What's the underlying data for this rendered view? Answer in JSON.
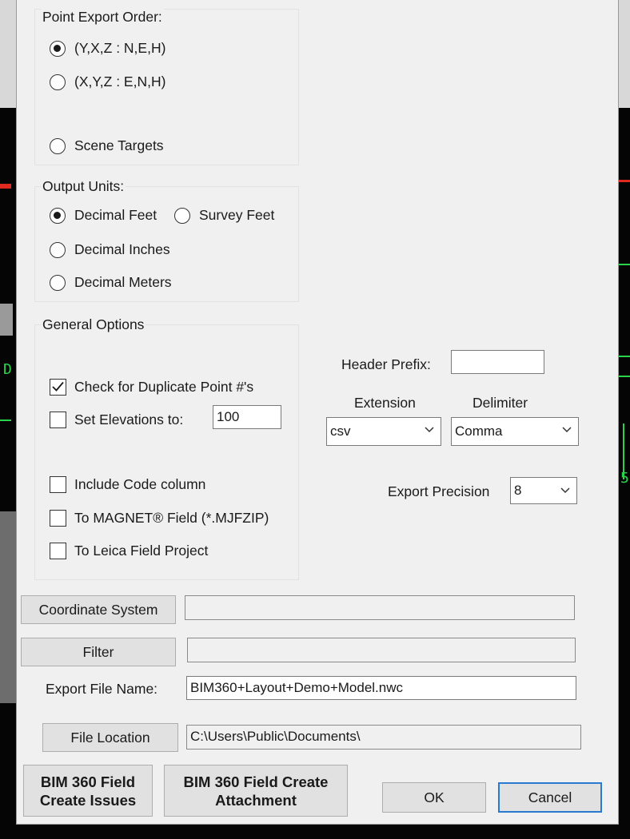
{
  "point_export_order": {
    "title": "Point Export Order:",
    "options": [
      {
        "label": "(Y,X,Z  :  N,E,H)",
        "checked": true
      },
      {
        "label": "(X,Y,Z  :  E,N,H)",
        "checked": false
      },
      {
        "label": "Scene Targets",
        "checked": false
      }
    ]
  },
  "output_units": {
    "title": "Output Units:",
    "options": [
      {
        "label": "Decimal Feet",
        "checked": true
      },
      {
        "label": "Survey Feet",
        "checked": false
      },
      {
        "label": "Decimal Inches",
        "checked": false
      },
      {
        "label": "Decimal Meters",
        "checked": false
      }
    ]
  },
  "general_options": {
    "title": "General Options",
    "check_duplicate": {
      "label": "Check for Duplicate Point #'s",
      "checked": true
    },
    "set_elevations": {
      "label": "Set Elevations to:",
      "checked": false,
      "value": "100"
    },
    "include_code": {
      "label": "Include Code column",
      "checked": false
    },
    "to_magnet": {
      "label": "To MAGNET® Field (*.MJFZIP)",
      "checked": false
    },
    "to_leica": {
      "label": "To Leica Field Project",
      "checked": false
    }
  },
  "header_prefix": {
    "label": "Header Prefix:",
    "value": ""
  },
  "extension": {
    "label": "Extension",
    "value": "csv"
  },
  "delimiter": {
    "label": "Delimiter",
    "value": "Comma"
  },
  "export_precision": {
    "label": "Export Precision",
    "value": "8"
  },
  "coordinate_system": {
    "button": "Coordinate System",
    "value": ""
  },
  "filter": {
    "button": "Filter",
    "value": ""
  },
  "export_file_name": {
    "label": "Export File Name:",
    "value": "BIM360+Layout+Demo+Model.nwc"
  },
  "file_location": {
    "button": "File Location",
    "value": "C:\\Users\\Public\\Documents\\"
  },
  "footer": {
    "bim_issues": "BIM 360 Field Create Issues",
    "bim_attachment": "BIM 360 Field Create Attachment",
    "ok": "OK",
    "cancel": "Cancel"
  },
  "background_glyphs": [
    "D",
    "5"
  ]
}
